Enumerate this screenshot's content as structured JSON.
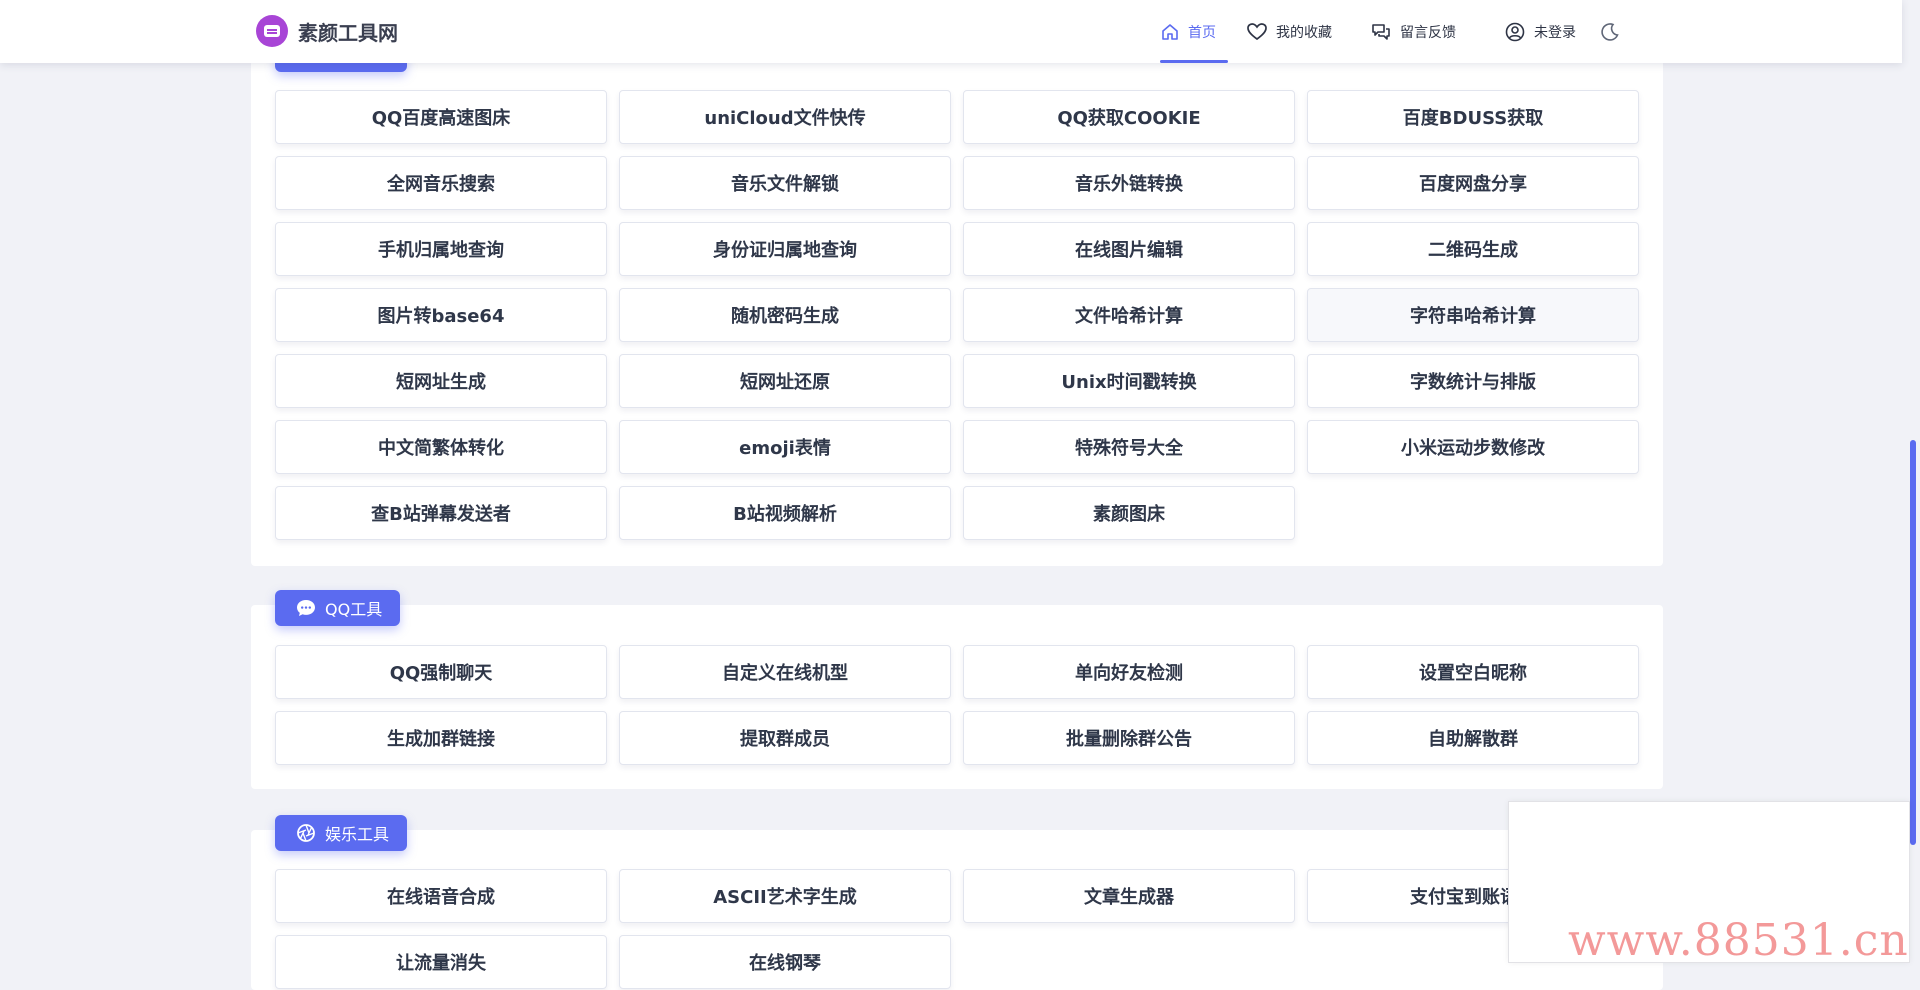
{
  "site": {
    "name": "素颜工具网"
  },
  "nav": {
    "home": "首页",
    "favorites": "我的收藏",
    "feedback": "留言反馈",
    "login": "未登录"
  },
  "sections": [
    {
      "title": "",
      "items": [
        "QQ百度高速图床",
        "uniCloud文件快传",
        "QQ获取COOKIE",
        "百度BDUSS获取",
        "全网音乐搜索",
        "音乐文件解锁",
        "音乐外链转换",
        "百度网盘分享",
        "手机归属地查询",
        "身份证归属地查询",
        "在线图片编辑",
        "二维码生成",
        "图片转base64",
        "随机密码生成",
        "文件哈希计算",
        "字符串哈希计算",
        "短网址生成",
        "短网址还原",
        "Unix时间戳转换",
        "字数统计与排版",
        "中文简繁体转化",
        "emoji表情",
        "特殊符号大全",
        "小米运动步数修改",
        "查B站弹幕发送者",
        "B站视频解析",
        "素颜图床"
      ]
    },
    {
      "title": "QQ工具",
      "items": [
        "QQ强制聊天",
        "自定义在线机型",
        "单向好友检测",
        "设置空白昵称",
        "生成加群链接",
        "提取群成员",
        "批量删除群公告",
        "自助解散群"
      ]
    },
    {
      "title": "娱乐工具",
      "items": [
        "在线语音合成",
        "ASCII艺术字生成",
        "文章生成器",
        "支付宝到账语音",
        "让流量消失",
        "在线钢琴"
      ]
    }
  ],
  "watermark": "www.88531.cn",
  "colors": {
    "accent": "#5b6bf0",
    "logo": "#a845d6",
    "background": "#f1f2f7",
    "watermark": "#ee6e6e"
  },
  "icons": {
    "logo": "logo-icon",
    "home": "home-icon",
    "favorites": "heart-icon",
    "feedback": "chat-icon",
    "login": "user-circle-icon",
    "theme": "moon-icon",
    "qq_section": "chat-bubble-icon",
    "fun_section": "aperture-icon"
  }
}
